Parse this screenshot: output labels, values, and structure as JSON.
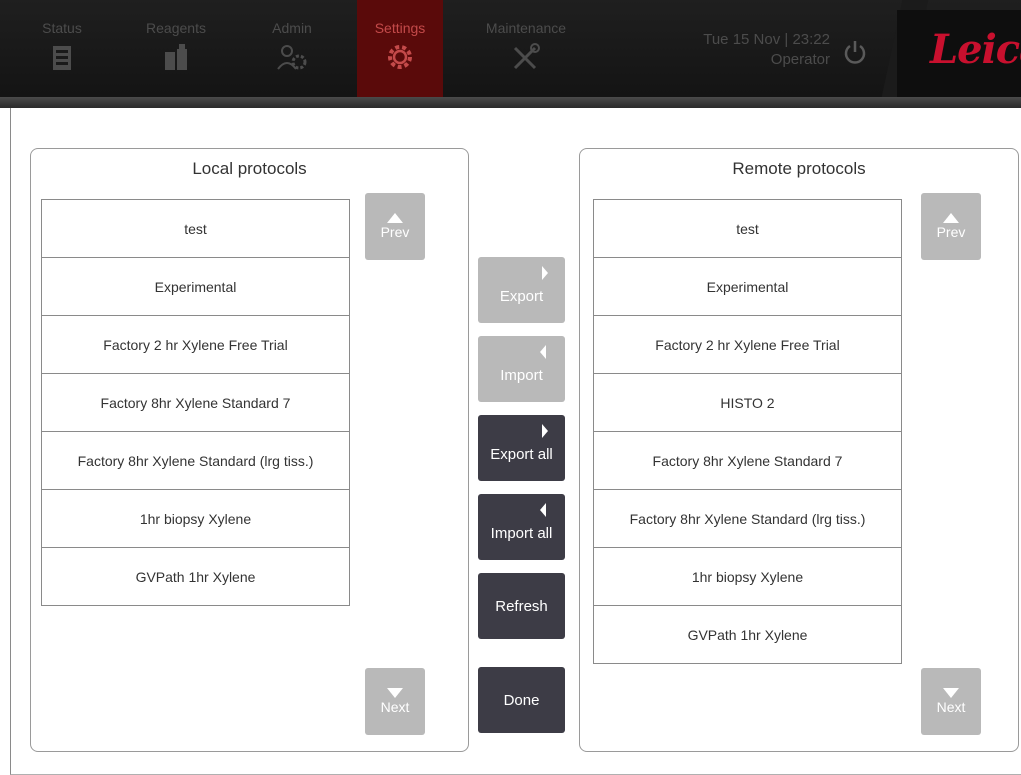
{
  "nav": {
    "tabs": [
      {
        "label": "Status",
        "icon": "status-icon"
      },
      {
        "label": "Reagents",
        "icon": "reagents-icon"
      },
      {
        "label": "Admin",
        "icon": "admin-icon"
      },
      {
        "label": "Settings",
        "icon": "settings-icon",
        "active": true
      },
      {
        "label": "Maintenance",
        "icon": "maintenance-icon"
      }
    ],
    "datetime": "Tue 15 Nov | 23:22",
    "user": "Operator",
    "brand": "Leica"
  },
  "colors": {
    "active_tab_bg": "#5a0a0a",
    "active_tab_text": "#c44a4a",
    "brand_red": "#c8102e",
    "button_enabled": "#3d3c46",
    "button_disabled": "#b9b9b9"
  },
  "local": {
    "title": "Local protocols",
    "items": [
      "test",
      "Experimental",
      "Factory 2 hr Xylene Free Trial",
      "Factory 8hr Xylene Standard 7",
      "Factory 8hr Xylene Standard (lrg tiss.)",
      "1hr biopsy Xylene",
      "GVPath 1hr Xylene"
    ],
    "prev": "Prev",
    "next": "Next"
  },
  "remote": {
    "title": "Remote protocols",
    "items": [
      "test",
      "Experimental",
      "Factory 2 hr Xylene Free Trial",
      "HISTO 2",
      "Factory 8hr Xylene Standard 7",
      "Factory 8hr Xylene Standard (lrg tiss.)",
      "1hr biopsy Xylene",
      "GVPath 1hr Xylene"
    ],
    "prev": "Prev",
    "next": "Next"
  },
  "actions": {
    "export": "Export",
    "import": "Import",
    "export_all": "Export all",
    "import_all": "Import all",
    "refresh": "Refresh",
    "done": "Done"
  }
}
